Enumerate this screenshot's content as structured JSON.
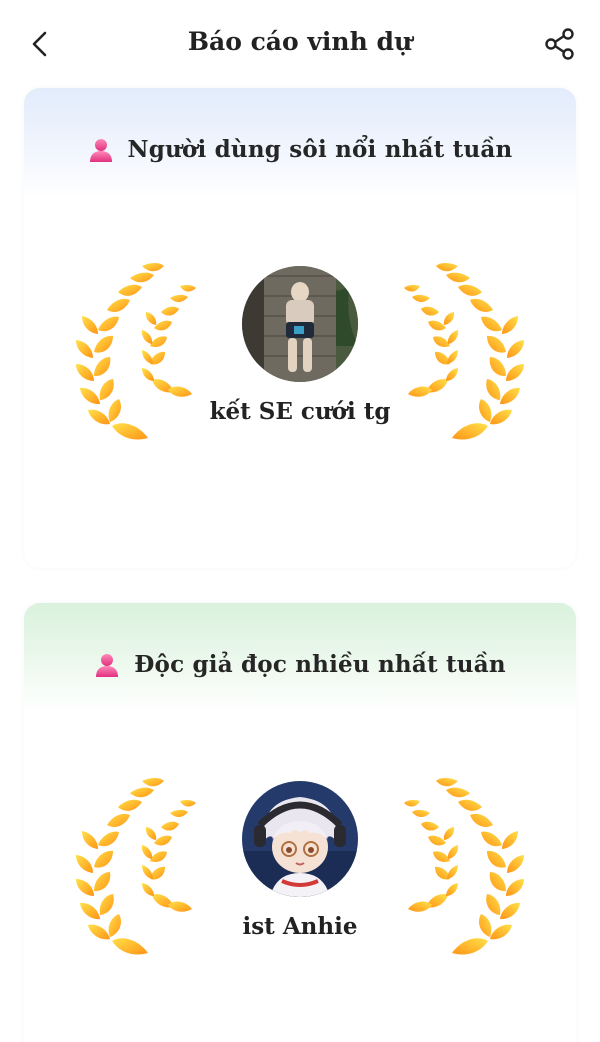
{
  "header": {
    "title": "Báo cáo vinh dự",
    "back_icon": "chevron-left-icon",
    "share_icon": "share-icon"
  },
  "cards": [
    {
      "heading": "Người dùng sôi nổi nhất tuần",
      "heading_icon": "user-pink-icon",
      "band_color": "#e2ecfb",
      "winner_name": "kết SE cưới tg"
    },
    {
      "heading": "Độc giả đọc nhiều nhất tuần",
      "heading_icon": "user-pink-icon",
      "band_color": "#daf2dd",
      "winner_name": "ist Anhie"
    }
  ],
  "colors": {
    "laurel_light": "#ffd23a",
    "laurel_dark": "#ff9a1c",
    "accent_pink": "#e8418c"
  }
}
